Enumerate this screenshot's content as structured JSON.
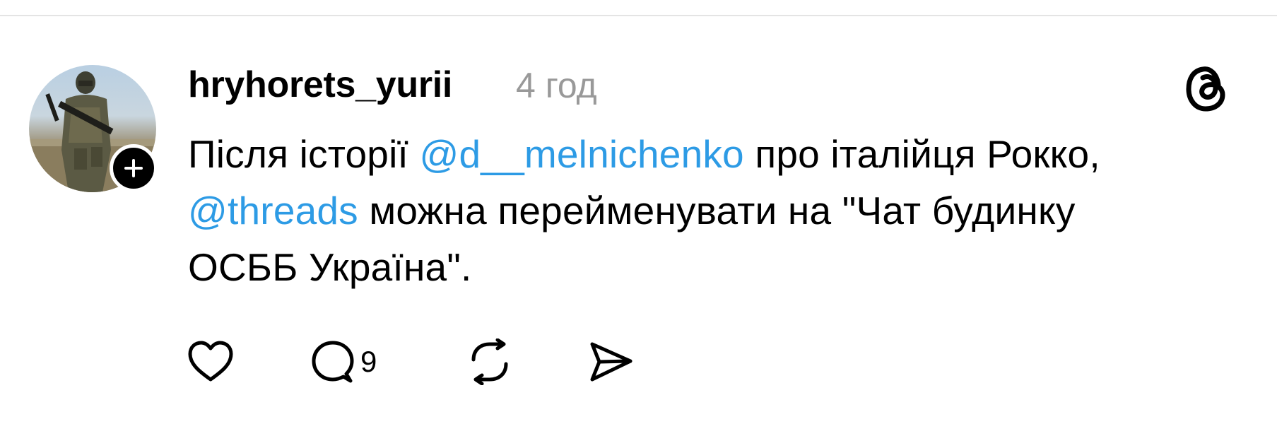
{
  "post": {
    "author": {
      "username": "hryhorets_yurii",
      "avatar_icon": "soldier-photo",
      "follow_icon": "plus-icon"
    },
    "timestamp": "4 год",
    "text": {
      "line1_part1": "Після історії ",
      "mention1": "@d__melnichenko",
      "line1_part2": " про італійця Рокко,",
      "mention2": "@threads",
      "line2_part": " можна перейменувати на \"Чат будинку",
      "line3": "ОСББ Україна\"."
    },
    "actions": {
      "like_icon": "heart-icon",
      "reply_icon": "comment-icon",
      "reply_count": "9",
      "repost_icon": "repost-icon",
      "share_icon": "send-icon"
    },
    "colors": {
      "mention": "#2d9be5",
      "timestamp": "#999999",
      "text": "#000000"
    }
  }
}
